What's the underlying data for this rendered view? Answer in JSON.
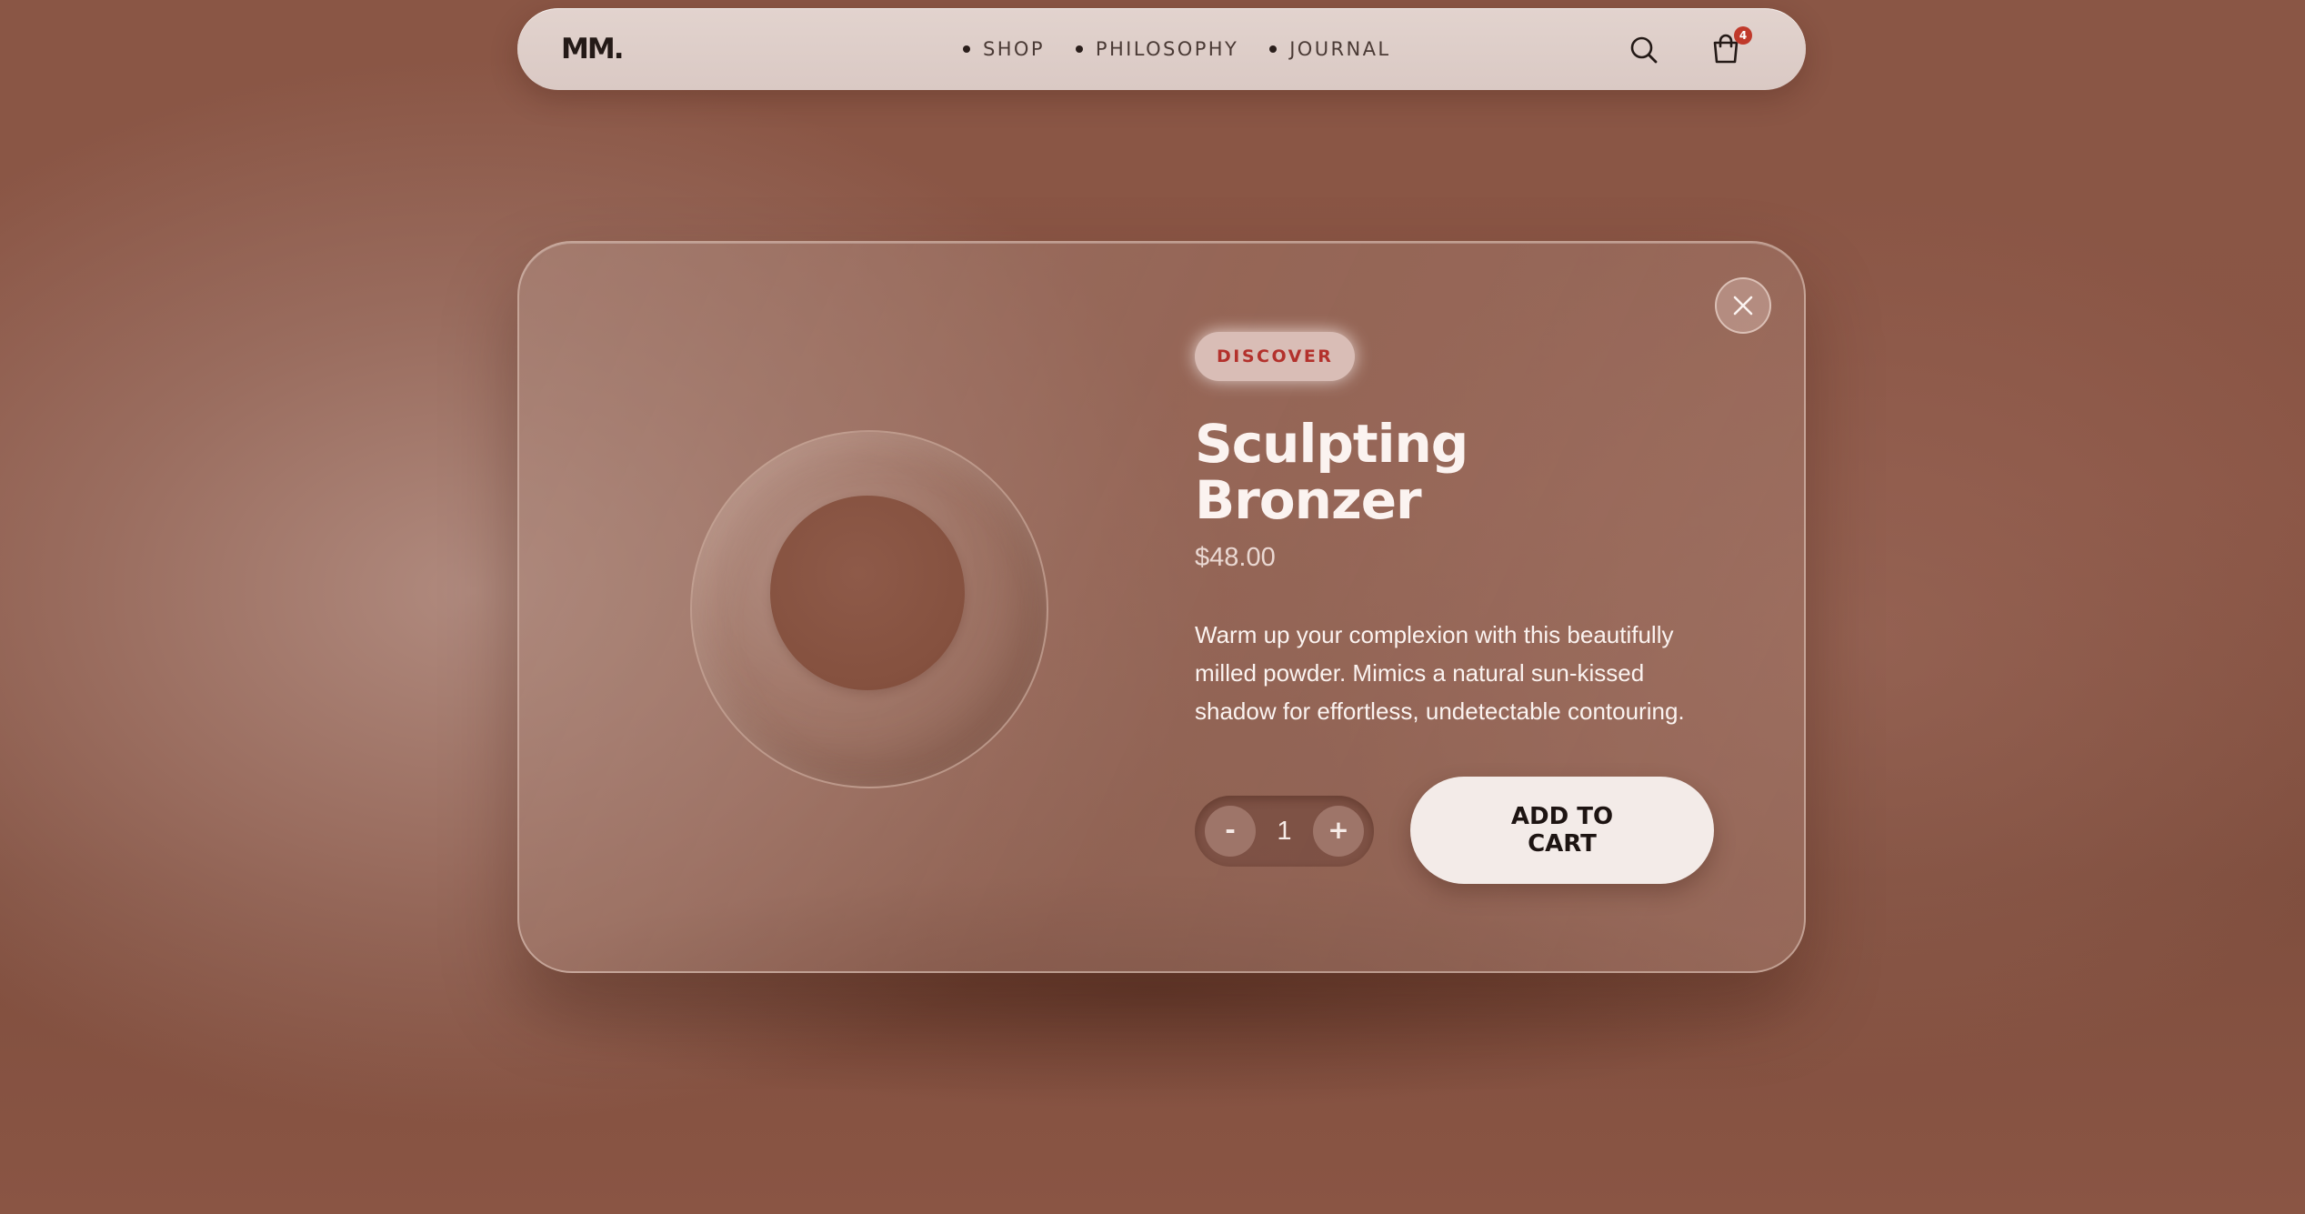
{
  "brand": {
    "logo": "MM."
  },
  "nav": {
    "items": [
      {
        "label": "SHOP"
      },
      {
        "label": "PHILOSOPHY"
      },
      {
        "label": "JOURNAL"
      }
    ]
  },
  "header_actions": {
    "search_icon": "search-icon",
    "cart_icon": "shopping-bag-icon",
    "cart_count": "4"
  },
  "modal": {
    "close_icon": "close-icon",
    "badge": "DISCOVER",
    "title": "Sculpting Bronzer",
    "price": "$48.00",
    "description": "Warm up your complexion with this beautifully milled powder. Mimics a natural sun-kissed shadow for effortless, undetectable contouring.",
    "quantity": {
      "decrement_label": "-",
      "value": "1",
      "increment_label": "+"
    },
    "add_to_cart_label": "ADD TO CART",
    "product_swatch_color": "#8a5544"
  },
  "colors": {
    "background": "#8a5645",
    "accent_red": "#b3312c",
    "button_light": "#f3ebe8",
    "text_light": "#fbf3f0"
  }
}
